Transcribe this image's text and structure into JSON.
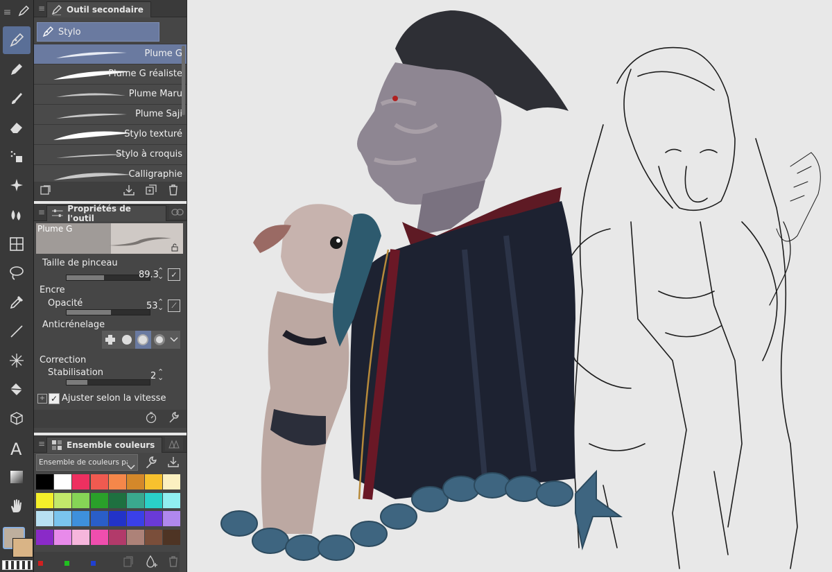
{
  "sub_tool": {
    "title": "Outil secondaire",
    "group": "Stylo",
    "brushes": [
      {
        "label": "Plume G",
        "selected": true
      },
      {
        "label": "Plume G réaliste",
        "selected": false
      },
      {
        "label": "Plume Maru",
        "selected": false
      },
      {
        "label": "Plume Saji",
        "selected": false
      },
      {
        "label": "Stylo texturé",
        "selected": false
      },
      {
        "label": "Stylo à croquis",
        "selected": false
      },
      {
        "label": "Calligraphie",
        "selected": false
      }
    ]
  },
  "tool_props": {
    "title": "Propriétés de l'outil",
    "preview_name": "Plume G",
    "brush_size_label": "Taille de pinceau",
    "brush_size_value": "89.3",
    "ink_label": "Encre",
    "opacity_label": "Opacité",
    "opacity_value": "53",
    "antialias_label": "Anticrénelage",
    "correction_label": "Correction",
    "stabilization_label": "Stabilisation",
    "stabilization_value": "2",
    "speed_checkbox_label": "Ajuster selon la vitesse",
    "speed_checked": true,
    "brush_size_fraction": 0.45,
    "opacity_fraction": 0.53,
    "stabilization_fraction": 0.25
  },
  "color_set": {
    "title": "Ensemble couleurs",
    "dropdown_value": "Ensemble de couleurs par défaut",
    "swatches": [
      "#000000",
      "#ffffff",
      "#ee3060",
      "#f05a50",
      "#f5874a",
      "#d4882a",
      "#f7c12e",
      "#fbf0c0",
      "#f4ef2a",
      "#c2e86a",
      "#86d456",
      "#2aa02a",
      "#1e7040",
      "#3aa88e",
      "#2ad0c8",
      "#90eef0",
      "#b8e0f2",
      "#7ac4ee",
      "#3e90dc",
      "#2a5ec8",
      "#2233c8",
      "#3a40e8",
      "#6a3ad8",
      "#b088ee",
      "#8a2ac8",
      "#e88aea",
      "#f6b6dc",
      "#f04eae",
      "#b23a6a",
      "#ad8278",
      "#7a4e3a",
      "#4e3424"
    ]
  },
  "colors": {
    "main": "#beaf9e",
    "sub": "#d9b486",
    "accent": "#5a6f97",
    "rgb_dots": [
      "#d02020",
      "#20c020",
      "#2040d0"
    ]
  },
  "tools": [
    "pen-icon",
    "pencil-icon",
    "brush-icon",
    "eraser-icon",
    "airbrush-icon",
    "decoration-icon",
    "blend-icon",
    "ruler-icon",
    "lasso-icon",
    "eyedropper-icon",
    "line-icon",
    "magic-wand-icon",
    "fill-icon",
    "3d-icon",
    "text-icon",
    "gradient-icon",
    "hand-icon"
  ]
}
